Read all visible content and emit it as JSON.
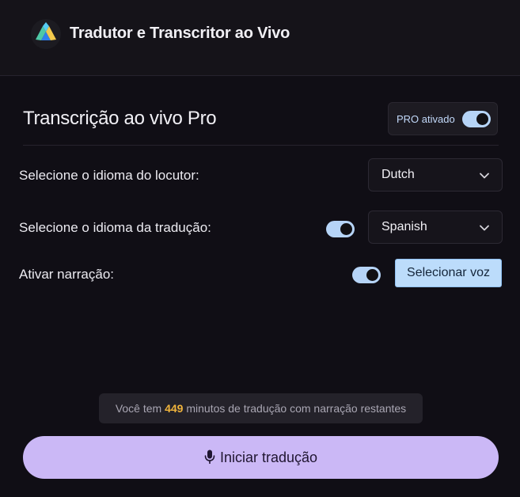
{
  "header": {
    "title": "Tradutor e Transcritor ao Vivo",
    "logo_icon": "mountain-logo-icon"
  },
  "section": {
    "title": "Transcrição ao vivo Pro",
    "pro_label": "PRO ativado",
    "pro_enabled": true
  },
  "speaker_language": {
    "label": "Selecione o idioma do locutor:",
    "value": "Dutch"
  },
  "translation_language": {
    "label": "Selecione o idioma da tradução:",
    "enabled": true,
    "value": "Spanish"
  },
  "narration": {
    "label": "Ativar narração:",
    "enabled": true,
    "voice_button_label": "Selecionar voz"
  },
  "minutes": {
    "prefix": "Você tem",
    "count": "449",
    "suffix": "minutos de tradução com narração restantes"
  },
  "start_button": {
    "label": "Iniciar tradução",
    "icon": "microphone-icon"
  },
  "colors": {
    "background": "#100e15",
    "header": "#151319",
    "toggle_on": "#b6d4f7",
    "primary_button": "#cbb8f6",
    "highlight_number": "#f0b43c",
    "voice_button": "#bcdcfb"
  }
}
